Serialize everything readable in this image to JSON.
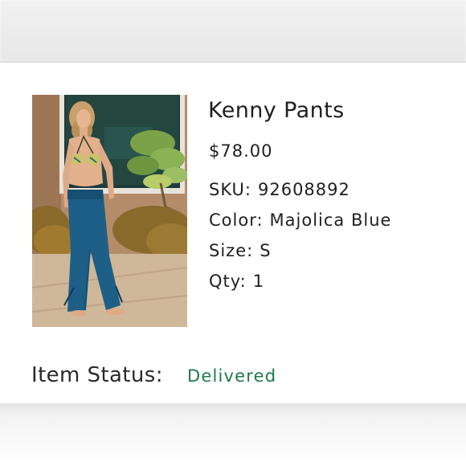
{
  "product": {
    "name": "Kenny Pants",
    "price": "$78.00",
    "image_alt": "model wearing blue wide-leg pants"
  },
  "attributes": {
    "sku_label": "SKU:",
    "sku_value": "92608892",
    "color_label": "Color:",
    "color_value": "Majolica Blue",
    "size_label": "Size:",
    "size_value": "S",
    "qty_label": "Qty:",
    "qty_value": "1"
  },
  "status": {
    "label": "Item Status:",
    "value": "Delivered"
  },
  "colors": {
    "status_green": "#1e7a4c",
    "text": "#1f1f1f",
    "pants_blue": "#1d5f86"
  }
}
